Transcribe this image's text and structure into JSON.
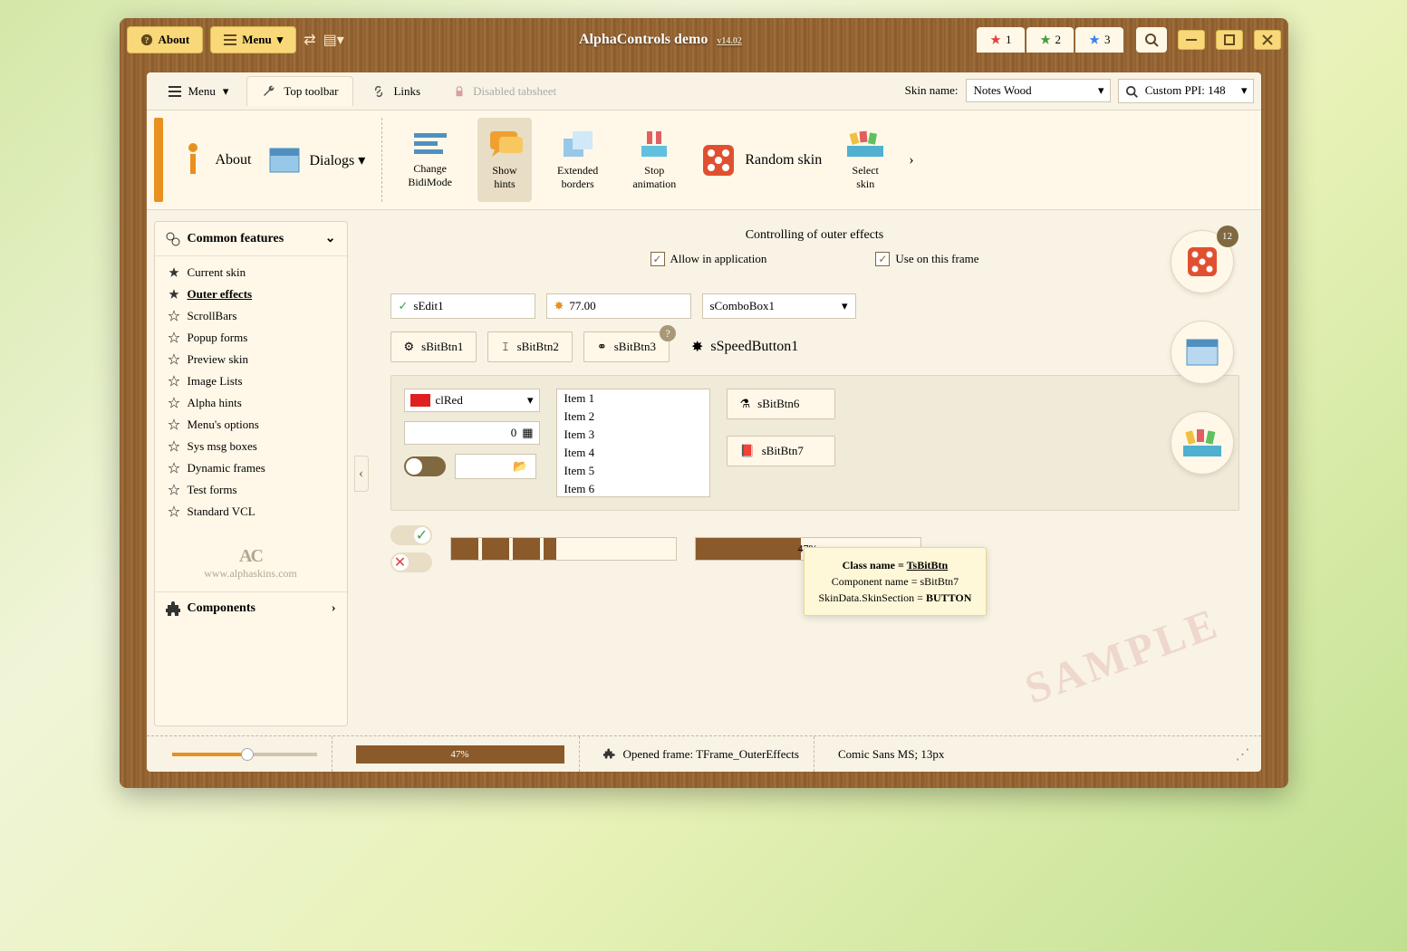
{
  "titlebar": {
    "about": "About",
    "menu": "Menu",
    "app_title": "AlphaControls demo",
    "version": "v14.02",
    "stars": [
      "1",
      "2",
      "3"
    ]
  },
  "tabs": {
    "menu": "Menu",
    "top_toolbar": "Top toolbar",
    "links": "Links",
    "disabled": "Disabled tabsheet",
    "skin_label": "Skin name:",
    "skin_value": "Notes Wood",
    "ppi": "Custom PPI: 148"
  },
  "toolbar": {
    "about": "About",
    "dialogs": "Dialogs",
    "change_bidi": "Change\nBidiMode",
    "show_hints": "Show\nhints",
    "ext_borders": "Extended\nborders",
    "stop_anim": "Stop\nanimation",
    "random_skin": "Random skin",
    "select_skin": "Select\nskin"
  },
  "sidebar": {
    "section1": "Common features",
    "items": [
      "Current skin",
      "Outer effects",
      "ScrollBars",
      "Popup forms",
      "Preview skin",
      "Image Lists",
      "Alpha hints",
      "Menu's options",
      "Sys msg boxes",
      "Dynamic frames",
      "Test forms",
      "Standard VCL"
    ],
    "footer_url": "www.alphaskins.com",
    "section2": "Components"
  },
  "content": {
    "group_title": "Controlling of outer effects",
    "allow": "Allow in application",
    "use_frame": "Use on this frame",
    "edit1": "sEdit1",
    "edit2": "77.00",
    "combo1": "sComboBox1",
    "btn1": "sBitBtn1",
    "btn2": "sBitBtn2",
    "btn3": "sBitBtn3",
    "speed1": "sSpeedButton1",
    "color": "clRed",
    "num": "0",
    "list": [
      "Item 1",
      "Item 2",
      "Item 3",
      "Item 4",
      "Item 5",
      "Item 6"
    ],
    "btn6": "sBitBtn6",
    "btn7": "sBitBtn7",
    "badge": "12",
    "progress_pct": "47%"
  },
  "tooltip": {
    "l1a": "Class name = ",
    "l1b": "TsBitBtn",
    "l2": "Component name = sBitBtn7",
    "l3a": "SkinData.SkinSection = ",
    "l3b": "BUTTON"
  },
  "watermark": "SAMPLE",
  "status": {
    "progress": "47%",
    "frame": "Opened frame: TFrame_OuterEffects",
    "font": "Comic Sans MS; 13px"
  }
}
